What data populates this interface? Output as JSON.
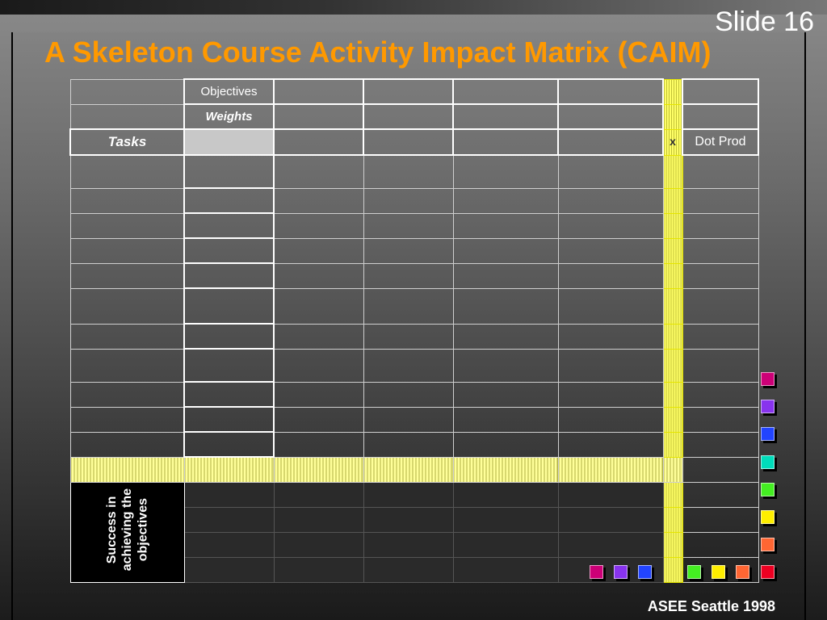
{
  "slide": {
    "number_label": "Slide 16",
    "title": "A Skeleton Course Activity Impact Matrix (CAIM)",
    "footer": "ASEE Seattle 1998"
  },
  "matrix": {
    "objectives_label": "Objectives",
    "weights_label": "Weights",
    "tasks_label": "Tasks",
    "dot_product_label": "Dot Prod",
    "success_label_line1": "Success in",
    "success_label_line2": "achieving the",
    "success_label_line3": "objectives",
    "stripe_marker": "x"
  },
  "colors": {
    "title": "#ff9900",
    "highlight": "#ffff66",
    "markers_right": [
      "#cc0077",
      "#8833ee",
      "#2244ff",
      "#00ddbb",
      "#44ee22",
      "#ffee00",
      "#ff6633",
      "#ee0022"
    ],
    "markers_bottom": [
      "#cc0077",
      "#8833ee",
      "#2244ff",
      "#44ee22",
      "#ffee00",
      "#ff6633"
    ]
  }
}
